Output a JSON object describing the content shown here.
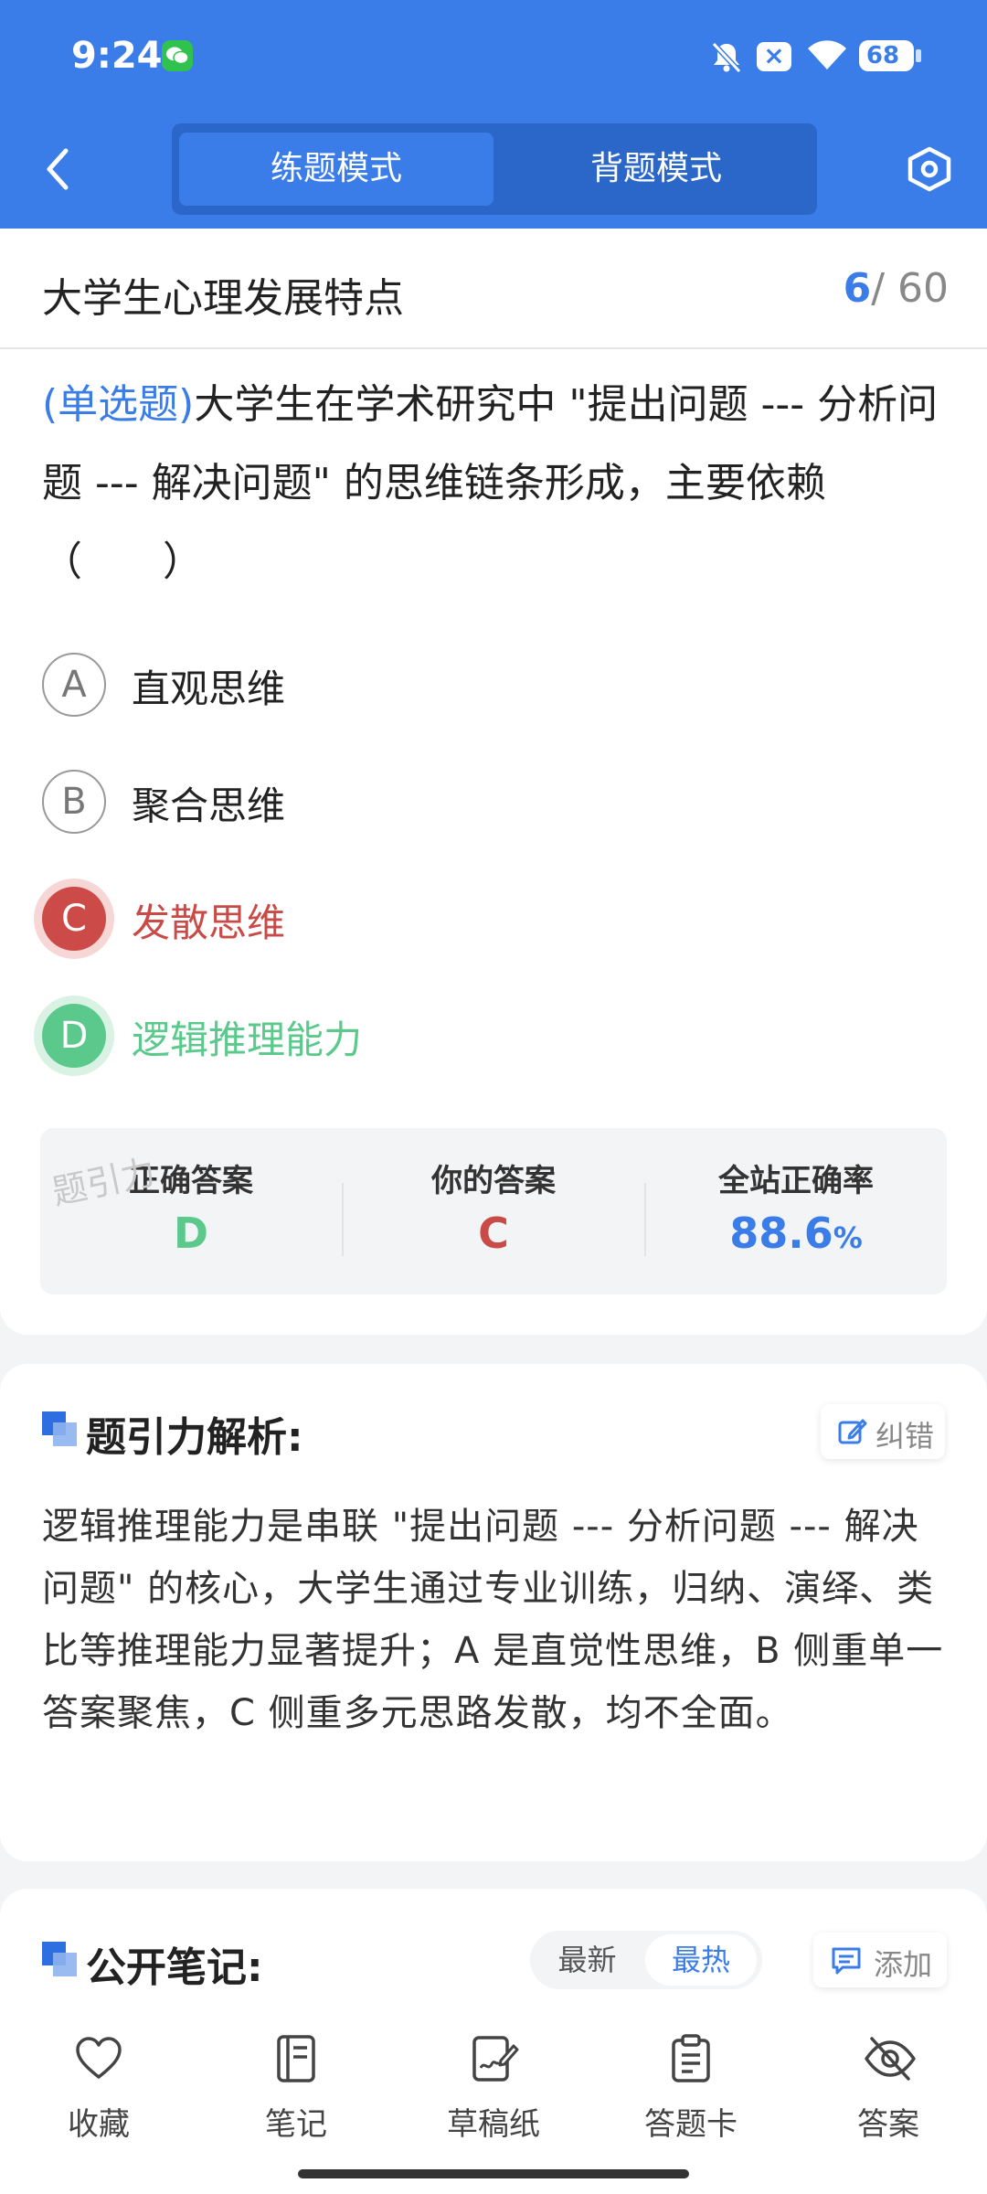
{
  "status_bar": {
    "time": "9:24",
    "battery": "68"
  },
  "header": {
    "tabs": [
      {
        "label": "练题模式",
        "active": true
      },
      {
        "label": "背题模式",
        "active": false
      }
    ]
  },
  "question": {
    "chapter": "大学生心理发展特点",
    "progress_current": "6",
    "progress_total": "/ 60",
    "type_label": "(单选题)",
    "text": "大学生在学术研究中 \"提出问题 --- 分析问题 --- 解决问题\" 的思维链条形成，主要依赖（　　）",
    "options": [
      {
        "letter": "A",
        "text": "直观思维",
        "state": "normal"
      },
      {
        "letter": "B",
        "text": "聚合思维",
        "state": "normal"
      },
      {
        "letter": "C",
        "text": "发散思维",
        "state": "wrong"
      },
      {
        "letter": "D",
        "text": "逻辑推理能力",
        "state": "right"
      }
    ]
  },
  "result": {
    "watermark": "题引力",
    "correct_label": "正确答案",
    "correct_value": "D",
    "yours_label": "你的答案",
    "yours_value": "C",
    "rate_label": "全站正确率",
    "rate_value": "88.6",
    "rate_unit": "%"
  },
  "analysis": {
    "title": "题引力解析:",
    "correct_button": "纠错",
    "text": "逻辑推理能力是串联 \"提出问题 --- 分析问题 --- 解决问题\" 的核心，大学生通过专业训练，归纳、演绎、类比等推理能力显著提升；A 是直觉性思维，B 侧重单一答案聚焦，C 侧重多元思路发散，均不全面。"
  },
  "notes": {
    "title": "公开笔记:",
    "sort_new": "最新",
    "sort_hot": "最热",
    "add_button": "添加"
  },
  "bottom_nav": [
    {
      "label": "收藏",
      "icon": "heart-icon"
    },
    {
      "label": "笔记",
      "icon": "notebook-icon"
    },
    {
      "label": "草稿纸",
      "icon": "draft-icon"
    },
    {
      "label": "答题卡",
      "icon": "clipboard-icon"
    },
    {
      "label": "答案",
      "icon": "eye-off-icon"
    }
  ],
  "colors": {
    "primary": "#3b7de8",
    "wrong": "#c84b47",
    "right": "#5bc98c"
  }
}
